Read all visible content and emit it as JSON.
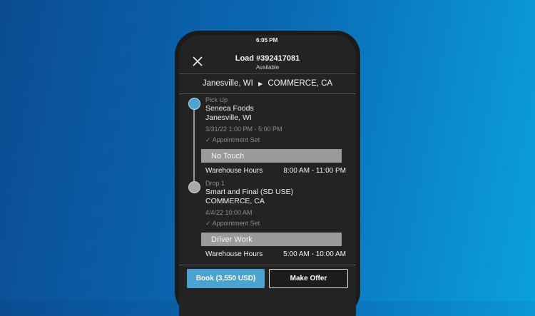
{
  "status_bar": {
    "time": "6:05 PM"
  },
  "header": {
    "title": "Load #392417081",
    "subtitle": "Available"
  },
  "route": {
    "origin": "Janesville, WI",
    "destination": "COMMERCE, CA"
  },
  "stops": [
    {
      "type": "Pick Up",
      "name": "Seneca Foods",
      "city": "Janesville, WI",
      "datetime": "3/31/22 1:00 PM - 5:00 PM",
      "appointment": "Appointment Set",
      "handling": "No Touch",
      "hours_label": "Warehouse Hours",
      "hours": "8:00 AM - 11:00 PM",
      "color": "#4aa3d0"
    },
    {
      "type": "Drop 1",
      "name": "Smart and Final (SD USE)",
      "city": "COMMERCE, CA",
      "datetime": "4/4/22 10:00 AM",
      "appointment": "Appointment Set",
      "handling": "Driver Work",
      "hours_label": "Warehouse Hours",
      "hours": "5:00 AM - 10:00 AM",
      "color": "#a8a8a8"
    }
  ],
  "actions": {
    "book": "Book (3,550 USD)",
    "offer": "Make Offer"
  }
}
